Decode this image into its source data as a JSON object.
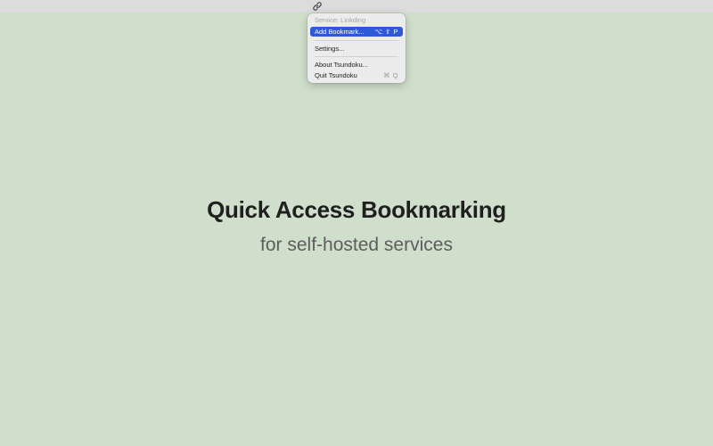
{
  "menubar": {
    "status_icon": "link-icon"
  },
  "menu": {
    "header": "Service: Linkding",
    "items": [
      {
        "label": "Add Bookmark...",
        "shortcut": "⌥ ⇧ P",
        "highlighted": true
      },
      {
        "label": "Settings...",
        "shortcut": ""
      },
      {
        "label": "About Tsundoku...",
        "shortcut": ""
      },
      {
        "label": "Quit Tsundoku",
        "shortcut": "⌘ Q"
      }
    ]
  },
  "hero": {
    "title": "Quick Access Bookmarking",
    "subtitle": "for self-hosted services"
  },
  "colors": {
    "background": "#d0dfcb",
    "menu_highlight": "#2f5ad7",
    "menubar": "#dcdcdc"
  }
}
